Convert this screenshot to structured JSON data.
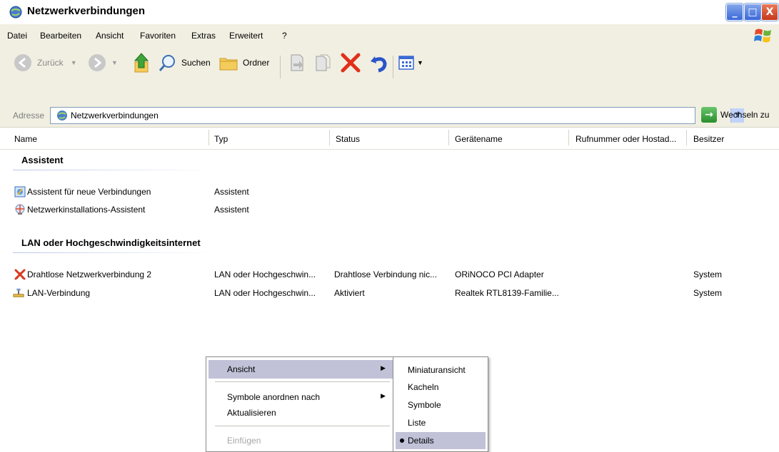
{
  "window": {
    "title": "Netzwerkverbindungen",
    "buttons": {
      "minimize": "_",
      "maximize": "□",
      "close": "X"
    }
  },
  "menubar": {
    "items": [
      "Datei",
      "Bearbeiten",
      "Ansicht",
      "Favoriten",
      "Extras",
      "Erweitert",
      "?"
    ]
  },
  "toolbar": {
    "back_label": "Zurück",
    "search_label": "Suchen",
    "folders_label": "Ordner"
  },
  "address": {
    "label": "Adresse",
    "value": "Netzwerkverbindungen",
    "go_label": "Wechseln zu"
  },
  "columns": [
    "Name",
    "Typ",
    "Status",
    "Gerätename",
    "Rufnummer oder Hostad...",
    "Besitzer"
  ],
  "groups": [
    {
      "heading": "Assistent",
      "rows": [
        {
          "name": "Assistent für neue Verbindungen",
          "type": "Assistent",
          "status": "",
          "device": "",
          "phone": "",
          "owner": ""
        },
        {
          "name": "Netzwerkinstallations-Assistent",
          "type": "Assistent",
          "status": "",
          "device": "",
          "phone": "",
          "owner": ""
        }
      ]
    },
    {
      "heading": "LAN oder Hochgeschwindigkeitsinternet",
      "rows": [
        {
          "name": "Drahtlose Netzwerkverbindung 2",
          "type": "LAN oder Hochgeschwin...",
          "status": "Drahtlose Verbindung nic...",
          "device": "ORiNOCO PCI Adapter",
          "phone": "",
          "owner": "System"
        },
        {
          "name": "LAN-Verbindung",
          "type": "LAN oder Hochgeschwin...",
          "status": "Aktiviert",
          "device": "Realtek RTL8139-Familie...",
          "phone": "",
          "owner": "System"
        }
      ]
    }
  ],
  "context_menu": {
    "items": [
      {
        "label": "Ansicht",
        "submenu": true,
        "highlighted": true,
        "disabled": false
      },
      {
        "label": "Symbole anordnen nach",
        "submenu": true,
        "highlighted": false,
        "disabled": false
      },
      {
        "label": "Aktualisieren",
        "submenu": false,
        "highlighted": false,
        "disabled": false
      },
      {
        "label": "Einfügen",
        "submenu": false,
        "highlighted": false,
        "disabled": true
      }
    ]
  },
  "view_submenu": {
    "items": [
      "Miniaturansicht",
      "Kacheln",
      "Symbole",
      "Liste",
      "Details"
    ],
    "selected": "Details"
  }
}
